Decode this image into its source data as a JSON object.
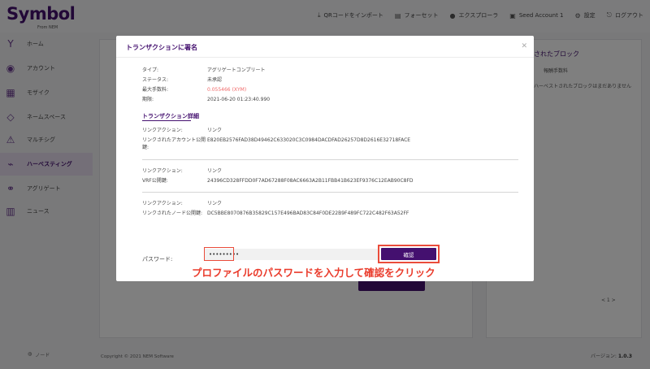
{
  "brand": {
    "name": "Symbol",
    "sub": "From NEM"
  },
  "topnav": [
    {
      "icon": "download-icon",
      "glyph": "⤓",
      "label": "QRコードをインポート"
    },
    {
      "icon": "faucet-icon",
      "glyph": "▤",
      "label": "フォーセット"
    },
    {
      "icon": "explorer-icon",
      "glyph": "●",
      "label": "エクスプローラ"
    },
    {
      "icon": "account-icon",
      "glyph": "▣",
      "label": "Seed Account 1"
    },
    {
      "icon": "gear-icon",
      "glyph": "⚙",
      "label": "設定"
    },
    {
      "icon": "logout-icon",
      "glyph": "⎋",
      "label": "ログアウト"
    }
  ],
  "sidebar": {
    "items": [
      {
        "label": "ホーム",
        "icon": "home-icon",
        "glyph": "Y"
      },
      {
        "label": "アカウント",
        "icon": "account-icon",
        "glyph": "◉"
      },
      {
        "label": "モザイク",
        "icon": "mosaic-icon",
        "glyph": "▦"
      },
      {
        "label": "ネームスペース",
        "icon": "namespace-icon",
        "glyph": "◇"
      },
      {
        "label": "マルチシグ",
        "icon": "multisig-icon",
        "glyph": "⚠"
      },
      {
        "label": "ハーベスティング",
        "icon": "harvesting-icon",
        "glyph": "⌁",
        "active": true
      },
      {
        "label": "アグリゲート",
        "icon": "aggregate-icon",
        "glyph": "⚭"
      },
      {
        "label": "ニュース",
        "icon": "news-icon",
        "glyph": "▥"
      }
    ],
    "node_label": "ノード"
  },
  "background": {
    "right_title": "されたブロック",
    "right_column": "報酬手数料",
    "right_empty": "ハーベストされたブロックはまだありません",
    "pager": "< 1 >"
  },
  "footer": {
    "copyright": "Copyright © 2021 NEM Software",
    "version_label": "バージョン:",
    "version": "1.0.3"
  },
  "modal": {
    "title": "トランザクションに署名",
    "summary": {
      "type_label": "タイプ:",
      "type_value": "アグリゲートコンプリート",
      "status_label": "ステータス:",
      "status_value": "未承認",
      "fee_label": "最大手数料:",
      "fee_value": "0.055466",
      "fee_unit": "(XYM)",
      "deadline_label": "期限:",
      "deadline_value": "2021-06-20 01:23:40.990"
    },
    "detail_heading": "トランザクション詳細",
    "details": [
      {
        "action_label": "リンクアクション:",
        "action_value": "リンク",
        "key_label": "リンクされたアカウント公開鍵:",
        "key_value": "E820EB2576FAD38D49462C633020C3C0984DACDFAD26257D8D2616E32718FACE"
      },
      {
        "action_label": "リンクアクション:",
        "action_value": "リンク",
        "key_label": "VRF公開鍵:",
        "key_value": "24396CD328FFDD0F7AD67288F08AC6663A2B11FBB41B623EF9376C12EAB90C8FD"
      },
      {
        "action_label": "リンクアクション:",
        "action_value": "リンク",
        "key_label": "リンクされたノード公開鍵:",
        "key_value": "DC5BBE8070876B35829C157E496BAD83C84F0DE22B9F489FC722C482F63A52FF"
      }
    ],
    "password_label": "パスワード:",
    "password_value": "•••••••••",
    "confirm_label": "確認"
  },
  "annotation": "プロファイルのパスワードを入力して確認をクリック",
  "colors": {
    "brand_purple": "#44106f",
    "highlight_red": "#ea4c3b",
    "fee_red": "#f06a6a"
  }
}
